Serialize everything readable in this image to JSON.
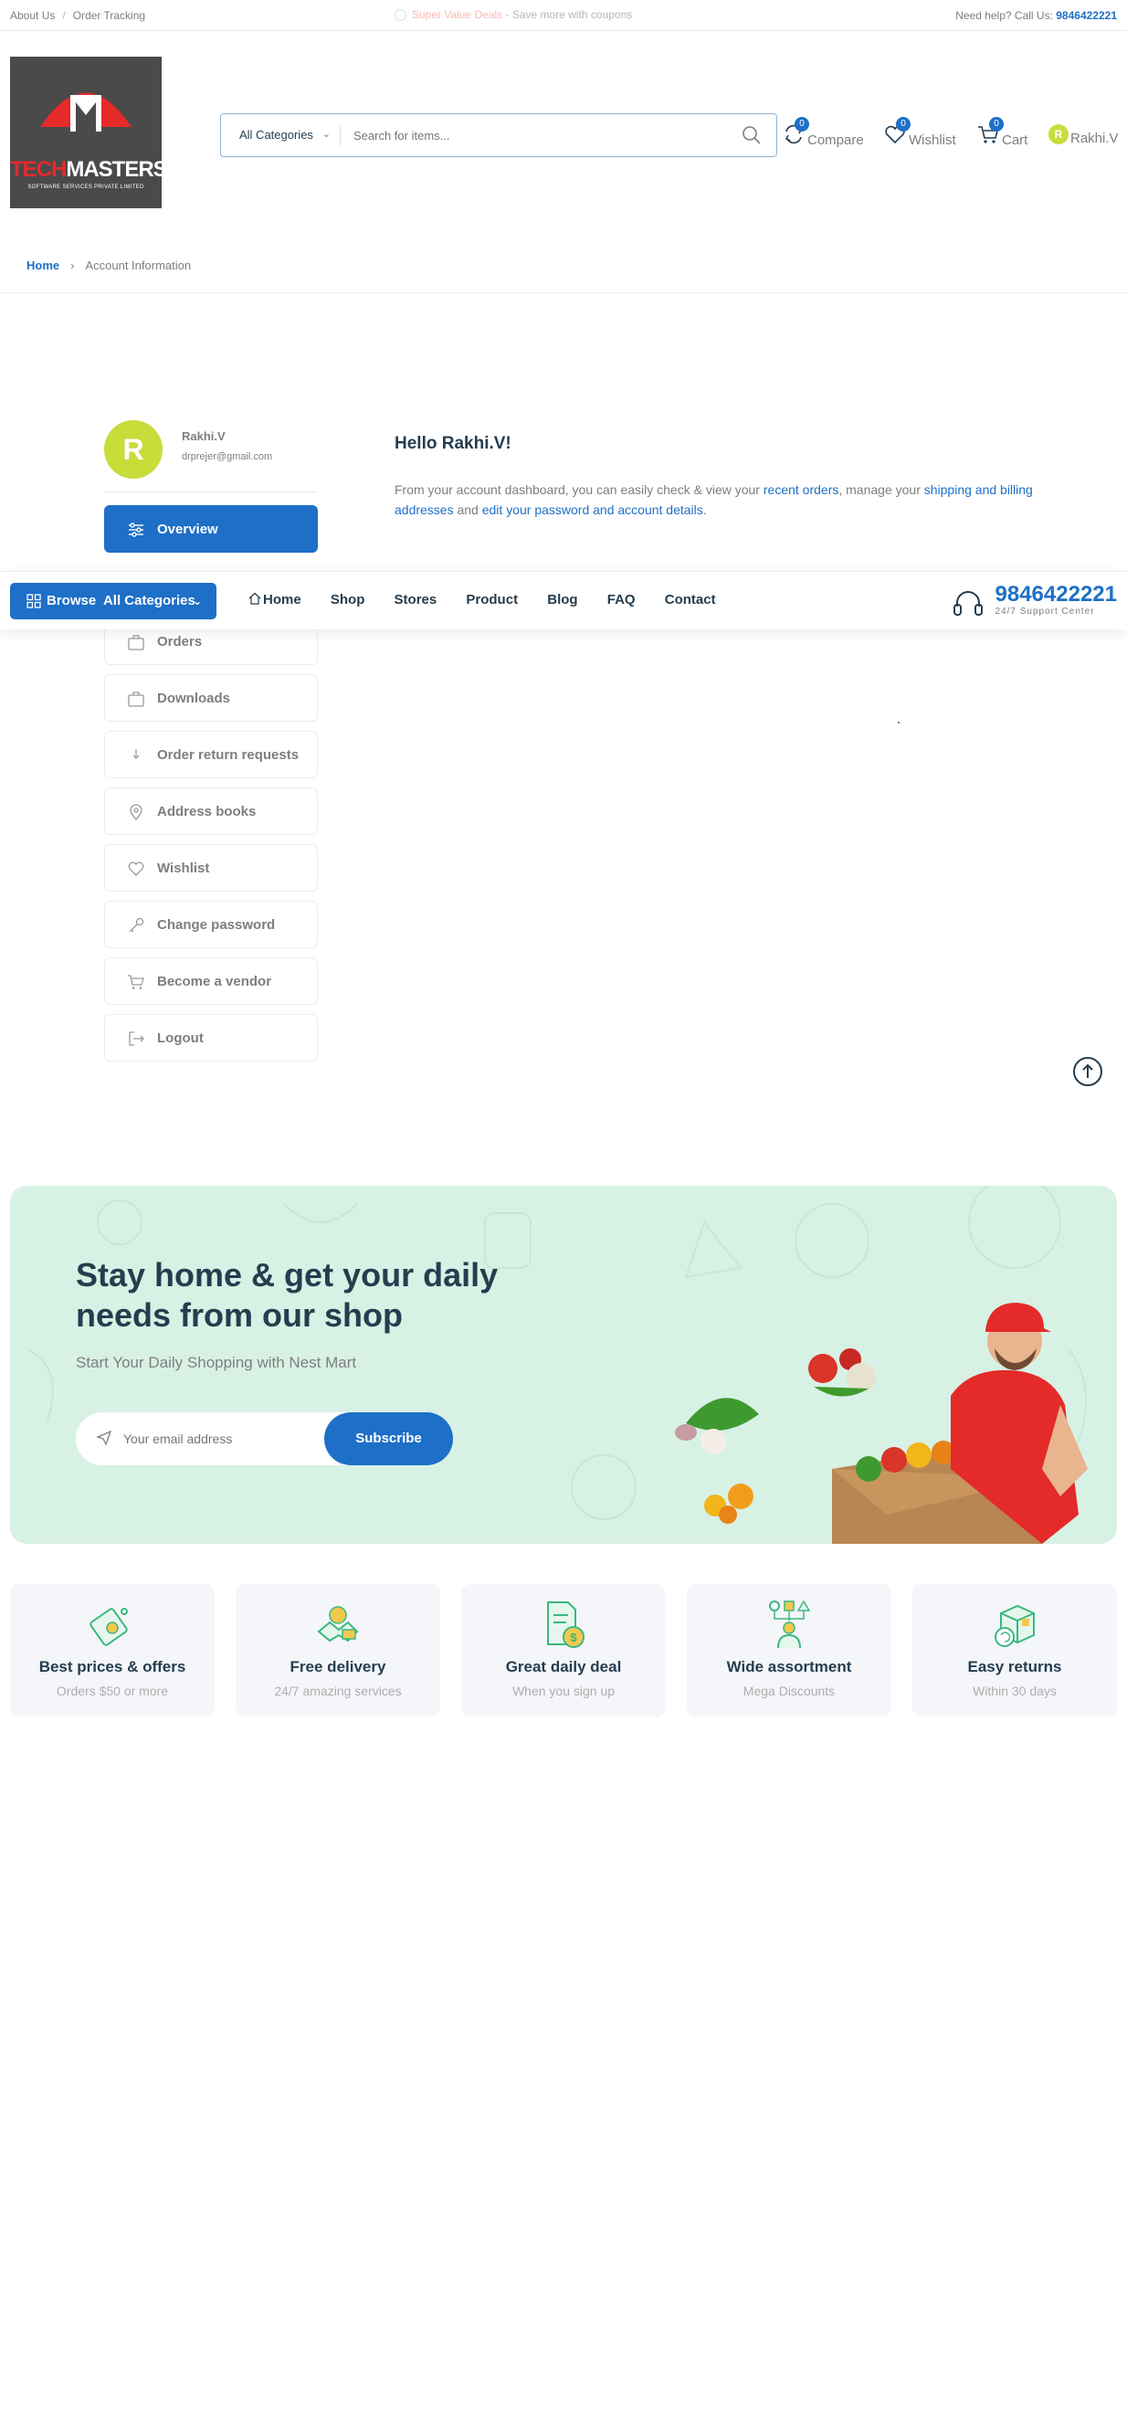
{
  "topbar": {
    "about": "About Us",
    "tracking": "Order Tracking",
    "promo_strong": "Super Value Deals",
    "promo_rest": " - Save more with coupons",
    "help_prefix": "Need help? Call Us: ",
    "help_phone": "9846422221"
  },
  "logo": {
    "brand_t": "TECH",
    "brand_rest": "MASTERS",
    "subtitle": "SOFTWARE SERVICES PRIVATE LIMITED"
  },
  "search": {
    "category": "All Categories",
    "placeholder": "Search for items..."
  },
  "header": {
    "compare_label": "Compare",
    "compare_count": "0",
    "wishlist_label": "Wishlist",
    "wishlist_count": "0",
    "cart_label": "Cart",
    "cart_count": "0",
    "user_initial": "R",
    "user_name": "Rakhi.V"
  },
  "breadcrumb": {
    "home": "Home",
    "current": "Account Information"
  },
  "profile": {
    "initial": "R",
    "name": "Rakhi.V",
    "email": "drprejer@gmail.com"
  },
  "menu": [
    {
      "label": "Overview"
    },
    {
      "label": "Orders"
    },
    {
      "label": "Downloads"
    },
    {
      "label": "Order return requests"
    },
    {
      "label": "Address books"
    },
    {
      "label": "Wishlist"
    },
    {
      "label": "Change password"
    },
    {
      "label": "Become a vendor"
    },
    {
      "label": "Logout"
    }
  ],
  "dashboard": {
    "hello": "Hello Rakhi.V!",
    "intro_1": "From your account dashboard, you can easily check & view your ",
    "link_orders": "recent orders",
    "intro_2": ", manage your ",
    "link_addresses": "shipping and billing addresses",
    "intro_3": " and ",
    "link_password": "edit your password and account details",
    "intro_4": "."
  },
  "nav": {
    "browse_prefix": "Browse",
    "browse_label": "All Categories",
    "links": [
      "Home",
      "Shop",
      "Stores",
      "Product",
      "Blog",
      "FAQ",
      "Contact"
    ],
    "support_phone": "9846422221",
    "support_label": "24/7 Support Center"
  },
  "newsletter": {
    "title": "Stay home & get your daily needs from our shop",
    "subtitle": "Start Your Daily Shopping with Nest Mart",
    "placeholder": "Your email address",
    "button": "Subscribe"
  },
  "features": [
    {
      "title": "Best prices & offers",
      "subtitle": "Orders $50 or more"
    },
    {
      "title": "Free delivery",
      "subtitle": "24/7 amazing services"
    },
    {
      "title": "Great daily deal",
      "subtitle": "When you sign up"
    },
    {
      "title": "Wide assortment",
      "subtitle": "Mega Discounts"
    },
    {
      "title": "Easy returns",
      "subtitle": "Within 30 days"
    }
  ],
  "colors": {
    "primary": "#1E6FC7",
    "heading": "#253D4E",
    "muted": "#7E7E7E",
    "newsletter_bg": "#D8F1E5",
    "avatar": "#C8DC3A",
    "feature_icon": "#3BB77E"
  }
}
